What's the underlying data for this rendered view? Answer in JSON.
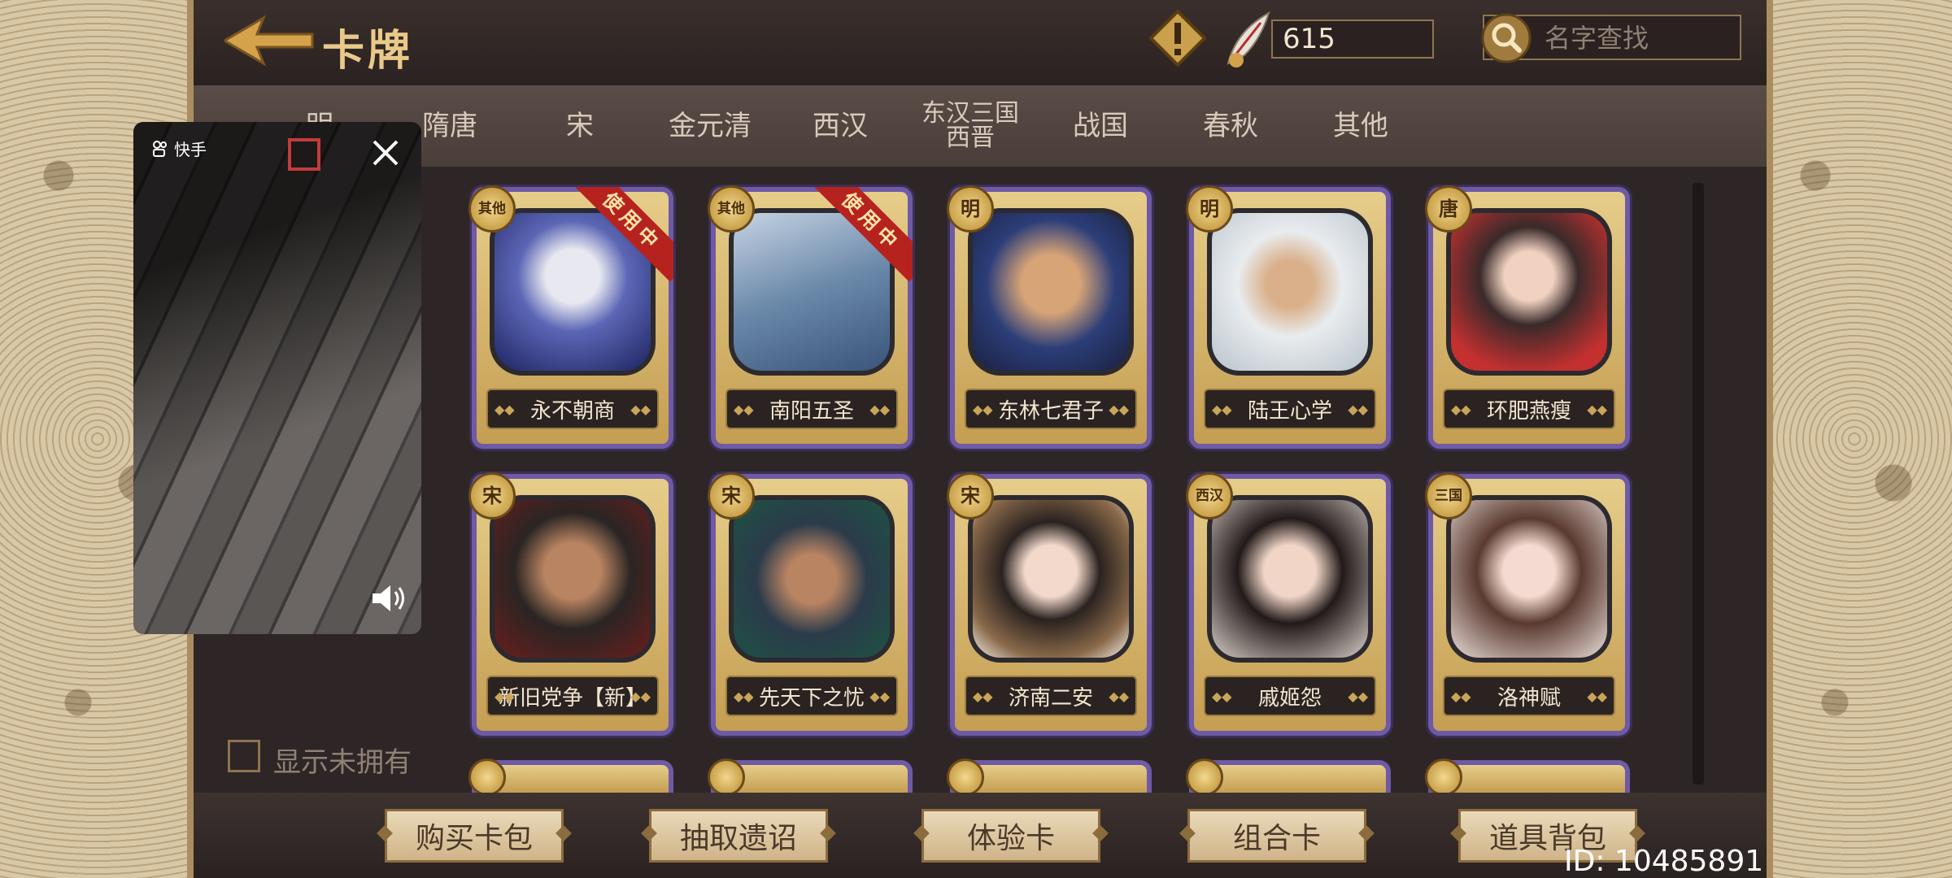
{
  "header": {
    "title": "卡牌",
    "currency_value": "615",
    "search_placeholder": "名字查找"
  },
  "tabs": [
    {
      "label": "明"
    },
    {
      "label": "隋唐"
    },
    {
      "label": "宋"
    },
    {
      "label": "金元清"
    },
    {
      "label": "西汉"
    },
    {
      "label": "东汉三国",
      "label2": "西晋"
    },
    {
      "label": "战国"
    },
    {
      "label": "春秋"
    },
    {
      "label": "其他"
    }
  ],
  "cards": [
    {
      "badge": "其他",
      "name": "永不朝商",
      "ribbon": "使用中"
    },
    {
      "badge": "其他",
      "name": "南阳五圣",
      "ribbon": "使用中"
    },
    {
      "badge": "明",
      "name": "东林七君子"
    },
    {
      "badge": "明",
      "name": "陆王心学"
    },
    {
      "badge": "唐",
      "name": "环肥燕瘦"
    },
    {
      "badge": "宋",
      "name": "新旧党争【新】"
    },
    {
      "badge": "宋",
      "name": "先天下之忧"
    },
    {
      "badge": "宋",
      "name": "济南二安"
    },
    {
      "badge": "西汉",
      "name": "戚姬怨"
    },
    {
      "badge": "三国",
      "name": "洛神赋"
    }
  ],
  "filter": {
    "show_unowned_label": "显示未拥有",
    "checked": false
  },
  "bottom_buttons": [
    {
      "label": "购买卡包"
    },
    {
      "label": "抽取遗诏"
    },
    {
      "label": "体验卡"
    },
    {
      "label": "组合卡"
    },
    {
      "label": "道具背包"
    }
  ],
  "user_id": "ID: 10485891",
  "video_overlay": {
    "brand": "快手"
  },
  "colors": {
    "panel_bg": "#2e2626",
    "title_gold": "#e9c98a",
    "card_frame": "#6e5aa6",
    "ribbon_red": "#b6231f",
    "button_bg": "#ead9b9"
  }
}
